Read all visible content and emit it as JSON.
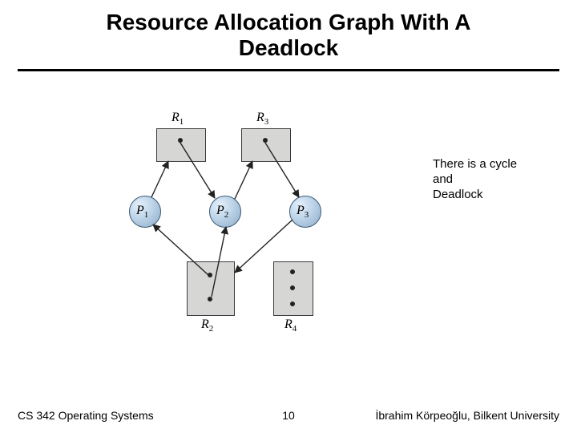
{
  "title_line1": "Resource Allocation Graph With A",
  "title_line2": "Deadlock",
  "note_line1": "There is a cycle",
  "note_line2": "and",
  "note_line3": "Deadlock",
  "footer_left": "CS 342 Operating Systems",
  "footer_page": "10",
  "footer_right": "İbrahim Körpeoğlu, Bilkent University",
  "labels": {
    "R1": "R",
    "R1s": "1",
    "R3": "R",
    "R3s": "3",
    "R2": "R",
    "R2s": "2",
    "R4": "R",
    "R4s": "4",
    "P1": "P",
    "P1s": "1",
    "P2": "P",
    "P2s": "2",
    "P3": "P",
    "P3s": "3"
  },
  "graph": {
    "resources": [
      {
        "id": "R1",
        "instances": 1
      },
      {
        "id": "R2",
        "instances": 2
      },
      {
        "id": "R3",
        "instances": 1
      },
      {
        "id": "R4",
        "instances": 3
      }
    ],
    "processes": [
      "P1",
      "P2",
      "P3"
    ],
    "assignment_edges": [
      {
        "from": "R1",
        "to": "P2"
      },
      {
        "from": "R2",
        "to": "P1"
      },
      {
        "from": "R2",
        "to": "P2"
      },
      {
        "from": "R3",
        "to": "P3"
      }
    ],
    "request_edges": [
      {
        "from": "P1",
        "to": "R1"
      },
      {
        "from": "P2",
        "to": "R3"
      },
      {
        "from": "P3",
        "to": "R2"
      }
    ],
    "has_cycle": true,
    "deadlock": true
  }
}
